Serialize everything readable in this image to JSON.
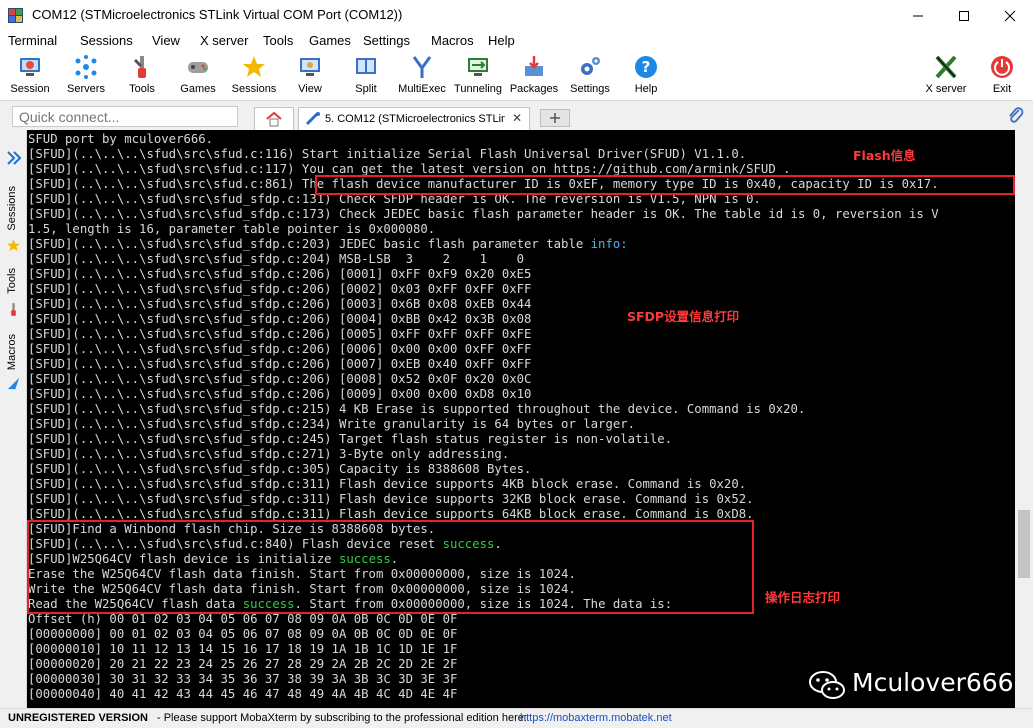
{
  "window": {
    "title": "COM12  (STMicroelectronics STLink Virtual COM Port (COM12))",
    "minimize_icon": "minimize-icon",
    "maximize_icon": "maximize-icon",
    "close_icon": "close-icon"
  },
  "menu": [
    "Terminal",
    "Sessions",
    "View",
    "X server",
    "Tools",
    "Games",
    "Settings",
    "Macros",
    "Help"
  ],
  "toolbar": [
    {
      "label": "Session",
      "icon": "session-icon"
    },
    {
      "label": "Servers",
      "icon": "servers-icon"
    },
    {
      "label": "Tools",
      "icon": "tools-icon"
    },
    {
      "label": "Games",
      "icon": "games-icon"
    },
    {
      "label": "Sessions",
      "icon": "star-icon"
    },
    {
      "label": "View",
      "icon": "view-icon"
    },
    {
      "label": "Split",
      "icon": "split-icon"
    },
    {
      "label": "MultiExec",
      "icon": "multiexec-icon"
    },
    {
      "label": "Tunneling",
      "icon": "tunneling-icon"
    },
    {
      "label": "Packages",
      "icon": "packages-icon"
    },
    {
      "label": "Settings",
      "icon": "settings-icon"
    },
    {
      "label": "Help",
      "icon": "help-icon"
    },
    {
      "label": "X server",
      "icon": "xserver-icon"
    },
    {
      "label": "Exit",
      "icon": "exit-icon"
    }
  ],
  "quick_connect": {
    "placeholder": "Quick connect..."
  },
  "tabs": {
    "home_icon": "home-icon",
    "session_tab_label": "5. COM12  (STMicroelectronics STLink",
    "new_tab_icon": "new-tab-icon"
  },
  "sidebar": [
    "Sessions",
    "Tools",
    "Macros"
  ],
  "terminal_lines": [
    "SFUD port by mculover666.",
    "[SFUD](..\\..\\..\\sfud\\src\\sfud.c:116) Start initialize Serial Flash Universal Driver(SFUD) V1.1.0.",
    "[SFUD](..\\..\\..\\sfud\\src\\sfud.c:117) You can get the latest version on https://github.com/armink/SFUD .",
    "[SFUD](..\\..\\..\\sfud\\src\\sfud.c:861) The flash device manufacturer ID is 0xEF, memory type ID is 0x40, capacity ID is 0x17.",
    "[SFUD](..\\..\\..\\sfud\\src\\sfud_sfdp.c:131) Check SFDP header is OK. The reversion is V1.5, NPN is 0.",
    "[SFUD](..\\..\\..\\sfud\\src\\sfud_sfdp.c:173) Check JEDEC basic flash parameter header is OK. The table id is 0, reversion is V",
    "1.5, length is 16, parameter table pointer is 0x000080.",
    "[SFUD](..\\..\\..\\sfud\\src\\sfud_sfdp.c:203) JEDEC basic flash parameter table ",
    "[SFUD](..\\..\\..\\sfud\\src\\sfud_sfdp.c:204) MSB-LSB  3    2    1    0",
    "[SFUD](..\\..\\..\\sfud\\src\\sfud_sfdp.c:206) [0001] 0xFF 0xF9 0x20 0xE5",
    "[SFUD](..\\..\\..\\sfud\\src\\sfud_sfdp.c:206) [0002] 0x03 0xFF 0xFF 0xFF",
    "[SFUD](..\\..\\..\\sfud\\src\\sfud_sfdp.c:206) [0003] 0x6B 0x08 0xEB 0x44",
    "[SFUD](..\\..\\..\\sfud\\src\\sfud_sfdp.c:206) [0004] 0xBB 0x42 0x3B 0x08",
    "[SFUD](..\\..\\..\\sfud\\src\\sfud_sfdp.c:206) [0005] 0xFF 0xFF 0xFF 0xFE",
    "[SFUD](..\\..\\..\\sfud\\src\\sfud_sfdp.c:206) [0006] 0x00 0x00 0xFF 0xFF",
    "[SFUD](..\\..\\..\\sfud\\src\\sfud_sfdp.c:206) [0007] 0xEB 0x40 0xFF 0xFF",
    "[SFUD](..\\..\\..\\sfud\\src\\sfud_sfdp.c:206) [0008] 0x52 0x0F 0x20 0x0C",
    "[SFUD](..\\..\\..\\sfud\\src\\sfud_sfdp.c:206) [0009] 0x00 0x00 0xD8 0x10",
    "[SFUD](..\\..\\..\\sfud\\src\\sfud_sfdp.c:215) 4 KB Erase is supported throughout the device. Command is 0x20.",
    "[SFUD](..\\..\\..\\sfud\\src\\sfud_sfdp.c:234) Write granularity is 64 bytes or larger.",
    "[SFUD](..\\..\\..\\sfud\\src\\sfud_sfdp.c:245) Target flash status register is non-volatile.",
    "[SFUD](..\\..\\..\\sfud\\src\\sfud_sfdp.c:271) 3-Byte only addressing.",
    "[SFUD](..\\..\\..\\sfud\\src\\sfud_sfdp.c:305) Capacity is 8388608 Bytes.",
    "[SFUD](..\\..\\..\\sfud\\src\\sfud_sfdp.c:311) Flash device supports 4KB block erase. Command is 0x20.",
    "[SFUD](..\\..\\..\\sfud\\src\\sfud_sfdp.c:311) Flash device supports 32KB block erase. Command is 0x52.",
    "[SFUD](..\\..\\..\\sfud\\src\\sfud_sfdp.c:311) Flash device supports 64KB block erase. Command is 0xD8.",
    "[SFUD]Find a Winbond flash chip. Size is 8388608 bytes.",
    "[SFUD](..\\..\\..\\sfud\\src\\sfud.c:840) Flash device reset ",
    "[SFUD]W25Q64CV flash device is initialize ",
    "Erase the W25Q64CV flash data finish. Start from 0x00000000, size is 1024.",
    "Write the W25Q64CV flash data finish. Start from 0x00000000, size is 1024.",
    "Read the W25Q64CV flash data ",
    "Offset (h) 00 01 02 03 04 05 06 07 08 09 0A 0B 0C 0D 0E 0F",
    "[00000000] 00 01 02 03 04 05 06 07 08 09 0A 0B 0C 0D 0E 0F",
    "[00000010] 10 11 12 13 14 15 16 17 18 19 1A 1B 1C 1D 1E 1F",
    "[00000020] 20 21 22 23 24 25 26 27 28 29 2A 2B 2C 2D 2E 2F",
    "[00000030] 30 31 32 33 34 35 36 37 38 39 3A 3B 3C 3D 3E 3F",
    "[00000040] 40 41 42 43 44 45 46 47 48 49 4A 4B 4C 4D 4E 4F"
  ],
  "terminal_inline": {
    "info_word": "info:",
    "success_word": "success",
    "success_period": ".",
    "read_tail": ". Start from 0x00000000, size is 1024. The data is:"
  },
  "annotations": {
    "flash_info": "Flash信息",
    "sfdp_info": "SFDP设置信息打印",
    "op_log": "操作日志打印"
  },
  "watermark": {
    "text": "Mculover666",
    "icon": "wechat-icon"
  },
  "status": {
    "unregistered": "UNREGISTERED VERSION",
    "message": " -  Please support MobaXterm by subscribing to the professional edition here: ",
    "link": "https://mobaxterm.mobatek.net"
  },
  "colors": {
    "terminal_bg": "#000000",
    "terminal_text": "#d8d8d8",
    "success_green": "#2ecc40",
    "info_cyan": "#4fb3e8",
    "annotation_red": "#e8202a"
  }
}
